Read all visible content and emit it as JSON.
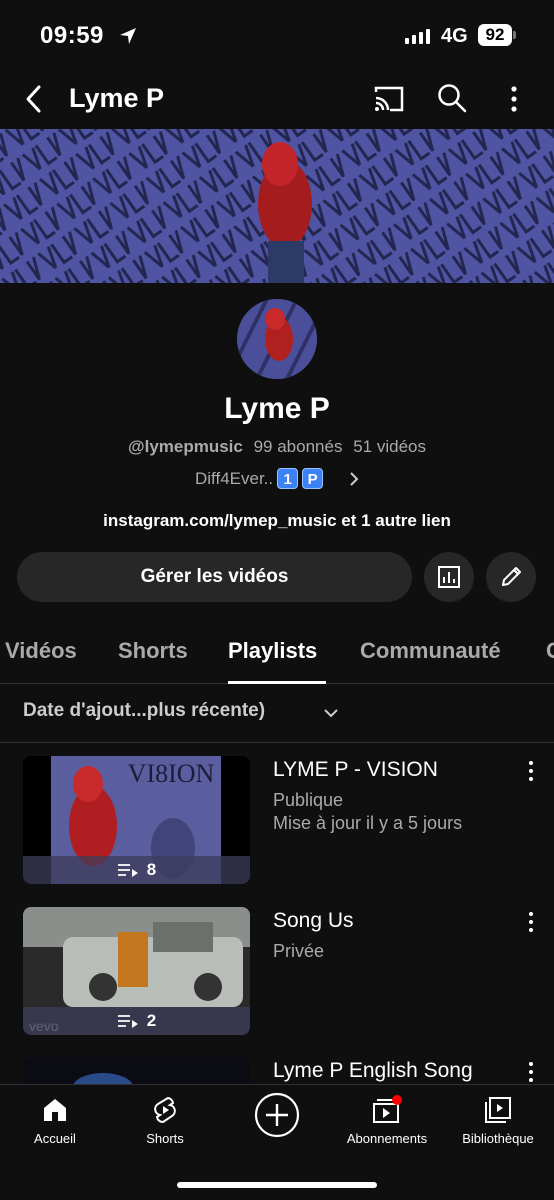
{
  "status": {
    "time": "09:59",
    "network": "4G",
    "battery": "92"
  },
  "topbar": {
    "title": "Lyme P"
  },
  "channel": {
    "name": "Lyme P",
    "handle": "@lymepmusic",
    "subscribers": "99 abonnés",
    "videos": "51 vidéos",
    "description": "Diff4Ever..",
    "emoji_1": "1",
    "emoji_2": "P",
    "link": "instagram.com/lymep_music et 1 autre lien"
  },
  "actions": {
    "manage_label": "Gérer les vidéos"
  },
  "tabs": [
    {
      "label": "Vidéos"
    },
    {
      "label": "Shorts"
    },
    {
      "label": "Playlists"
    },
    {
      "label": "Communauté"
    },
    {
      "label": "C"
    }
  ],
  "sort": {
    "label": "Date d'ajout...plus récente)"
  },
  "playlists": [
    {
      "title": "LYME P - VISION",
      "visibility": "Publique",
      "updated": "Mise à jour il y a 5 jours",
      "count": "8",
      "thumb_text": "VI8ION"
    },
    {
      "title": "Song Us",
      "visibility": "Privée",
      "count": "2",
      "watermark": "vevo"
    },
    {
      "title": "Lyme P English Song"
    }
  ],
  "nav": [
    {
      "label": "Accueil"
    },
    {
      "label": "Shorts"
    },
    {
      "label": "Abonnements"
    },
    {
      "label": "Bibliothèque"
    }
  ],
  "colors": {
    "background": "#0f0f0f",
    "banner": "#4b4f9a",
    "button": "#272727",
    "badge_red": "#ff0000"
  }
}
